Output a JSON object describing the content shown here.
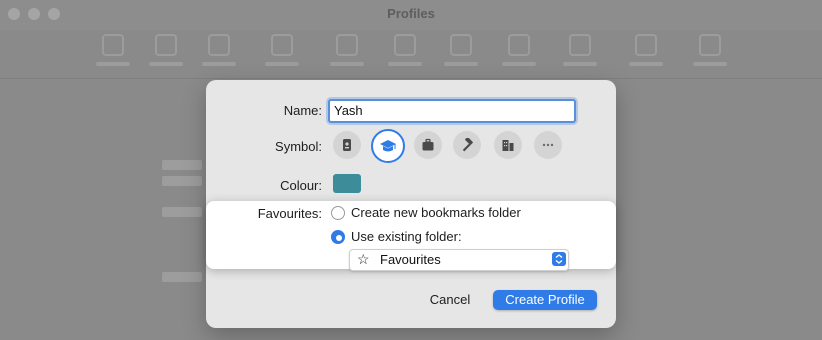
{
  "window": {
    "title": "Profiles"
  },
  "form": {
    "name_label": "Name:",
    "name_value": "Yash",
    "symbol_label": "Symbol:",
    "symbols": [
      "id-card-icon",
      "graduation-cap-icon",
      "briefcase-icon",
      "hammer-icon",
      "building-icon",
      "more-icon"
    ],
    "selected_symbol": "graduation-cap-icon",
    "colour_label": "Colour:",
    "colour_value": "#3d8c9a",
    "favourites_label": "Favourites:",
    "option_new": "Create new bookmarks folder",
    "option_existing": "Use existing folder:",
    "selected_option": "existing",
    "folder_select_value": "Favourites"
  },
  "buttons": {
    "cancel": "Cancel",
    "create": "Create Profile"
  },
  "colors": {
    "accent": "#2f7be8"
  }
}
